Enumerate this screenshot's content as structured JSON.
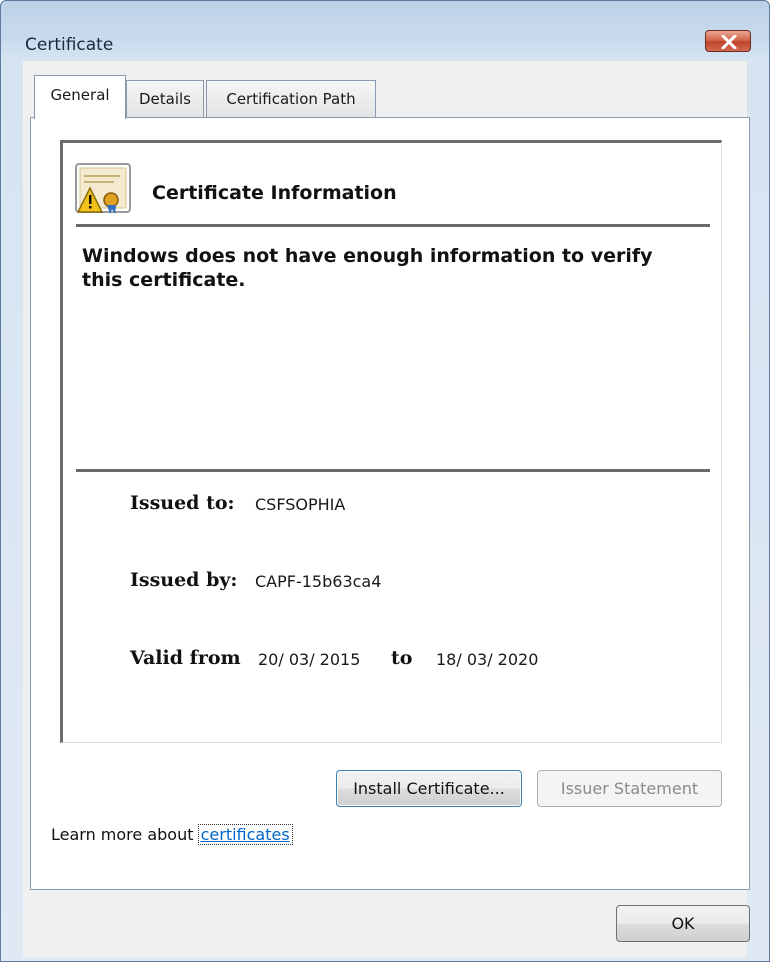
{
  "window": {
    "title": "Certificate",
    "close_icon": "close-icon"
  },
  "tabs": [
    {
      "label": "General",
      "active": true
    },
    {
      "label": "Details",
      "active": false
    },
    {
      "label": "Certification Path",
      "active": false
    }
  ],
  "general": {
    "icon": "certificate-warning-icon",
    "heading": "Certificate Information",
    "warning_text": "Windows does not have enough information to verify this certificate.",
    "issued_to_label": "Issued to:",
    "issued_to_value": "CSFSOPHIA",
    "issued_by_label": "Issued by:",
    "issued_by_value": "CAPF-15b63ca4",
    "valid_from_label": "Valid from",
    "valid_from_value": "20/ 03/ 2015",
    "valid_to_label": "to",
    "valid_to_value": "18/ 03/ 2020"
  },
  "buttons": {
    "install": "Install Certificate...",
    "issuer_statement": "Issuer Statement",
    "ok": "OK"
  },
  "learn_more": {
    "prefix": "Learn more about ",
    "link": "certificates"
  },
  "colors": {
    "link": "#0066cc",
    "close_button": "#c0442a",
    "warning_triangle": "#f2c21b"
  }
}
